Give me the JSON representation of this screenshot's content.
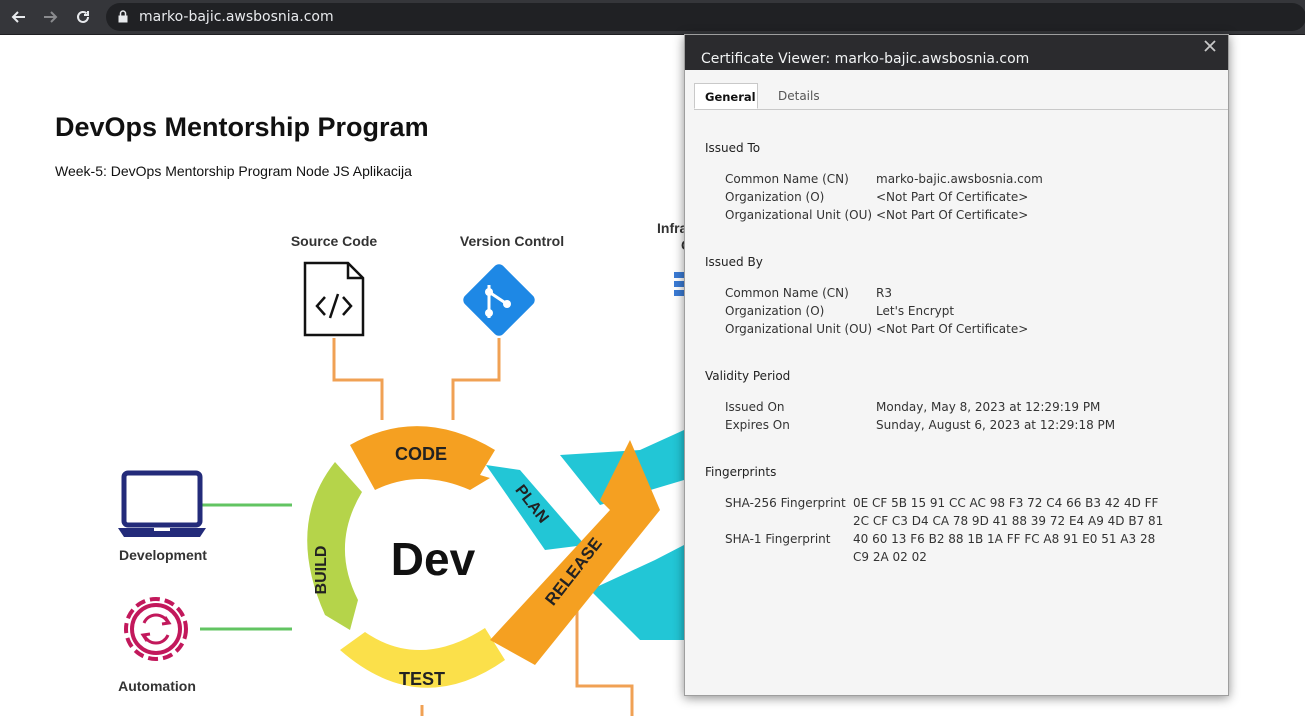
{
  "browser": {
    "url": "marko-bajic.awsbosnia.com",
    "back_icon": "back-arrow-icon",
    "forward_icon": "forward-arrow-icon",
    "reload_icon": "reload-icon",
    "lock_icon": "lock-icon"
  },
  "page": {
    "title": "DevOps Mentorship Program",
    "subtitle": "Week-5: DevOps Mentorship Program Node JS Aplikacija"
  },
  "diagram": {
    "source_code_label": "Source Code",
    "version_control_label": "Version Control",
    "infra_partial_label": "Infra",
    "infra_partial_label2": "C",
    "development_label": "Development",
    "automation_label": "Automation",
    "center_label": "Dev",
    "code_label": "CODE",
    "plan_label": "PLAN",
    "build_label": "BUILD",
    "test_label": "TEST",
    "release_label": "RELEASE",
    "colors": {
      "orange": "#f5a021",
      "cyan": "#22c6d6",
      "green": "#b5d44a",
      "yellow": "#fbe04a",
      "connector_orange": "#f0a154",
      "connector_green": "#62c462",
      "git_blue": "#1e88e5",
      "laptop_navy": "#232b7a",
      "gear_crimson": "#c2185b"
    }
  },
  "certificate": {
    "title": "Certificate Viewer: marko-bajic.awsbosnia.com",
    "close_icon": "close-icon",
    "tabs": {
      "general": "General",
      "details": "Details"
    },
    "issued_to": {
      "heading": "Issued To",
      "rows": [
        {
          "label": "Common Name (CN)",
          "value": "marko-bajic.awsbosnia.com"
        },
        {
          "label": "Organization (O)",
          "value": "<Not Part Of Certificate>"
        },
        {
          "label": "Organizational Unit (OU)",
          "value": "<Not Part Of Certificate>"
        }
      ]
    },
    "issued_by": {
      "heading": "Issued By",
      "rows": [
        {
          "label": "Common Name (CN)",
          "value": "R3"
        },
        {
          "label": "Organization (O)",
          "value": "Let's Encrypt"
        },
        {
          "label": "Organizational Unit (OU)",
          "value": "<Not Part Of Certificate>"
        }
      ]
    },
    "validity": {
      "heading": "Validity Period",
      "rows": [
        {
          "label": "Issued On",
          "value": "Monday, May 8, 2023 at 12:29:19 PM"
        },
        {
          "label": "Expires On",
          "value": "Sunday, August 6, 2023 at 12:29:18 PM"
        }
      ]
    },
    "fingerprints": {
      "heading": "Fingerprints",
      "sha256_label": "SHA-256 Fingerprint",
      "sha256_line1": "0E CF 5B 15 91 CC AC 98 F3 72 C4 66 B3 42 4D FF",
      "sha256_line2": "2C CF C3 D4 CA 78 9D 41 88 39 72 E4 A9 4D B7 81",
      "sha1_label": "SHA-1 Fingerprint",
      "sha1_line1": "40 60 13 F6 B2 88 1B 1A FF FC A8 91 E0 51 A3 28",
      "sha1_line2": "C9 2A 02 02"
    }
  }
}
